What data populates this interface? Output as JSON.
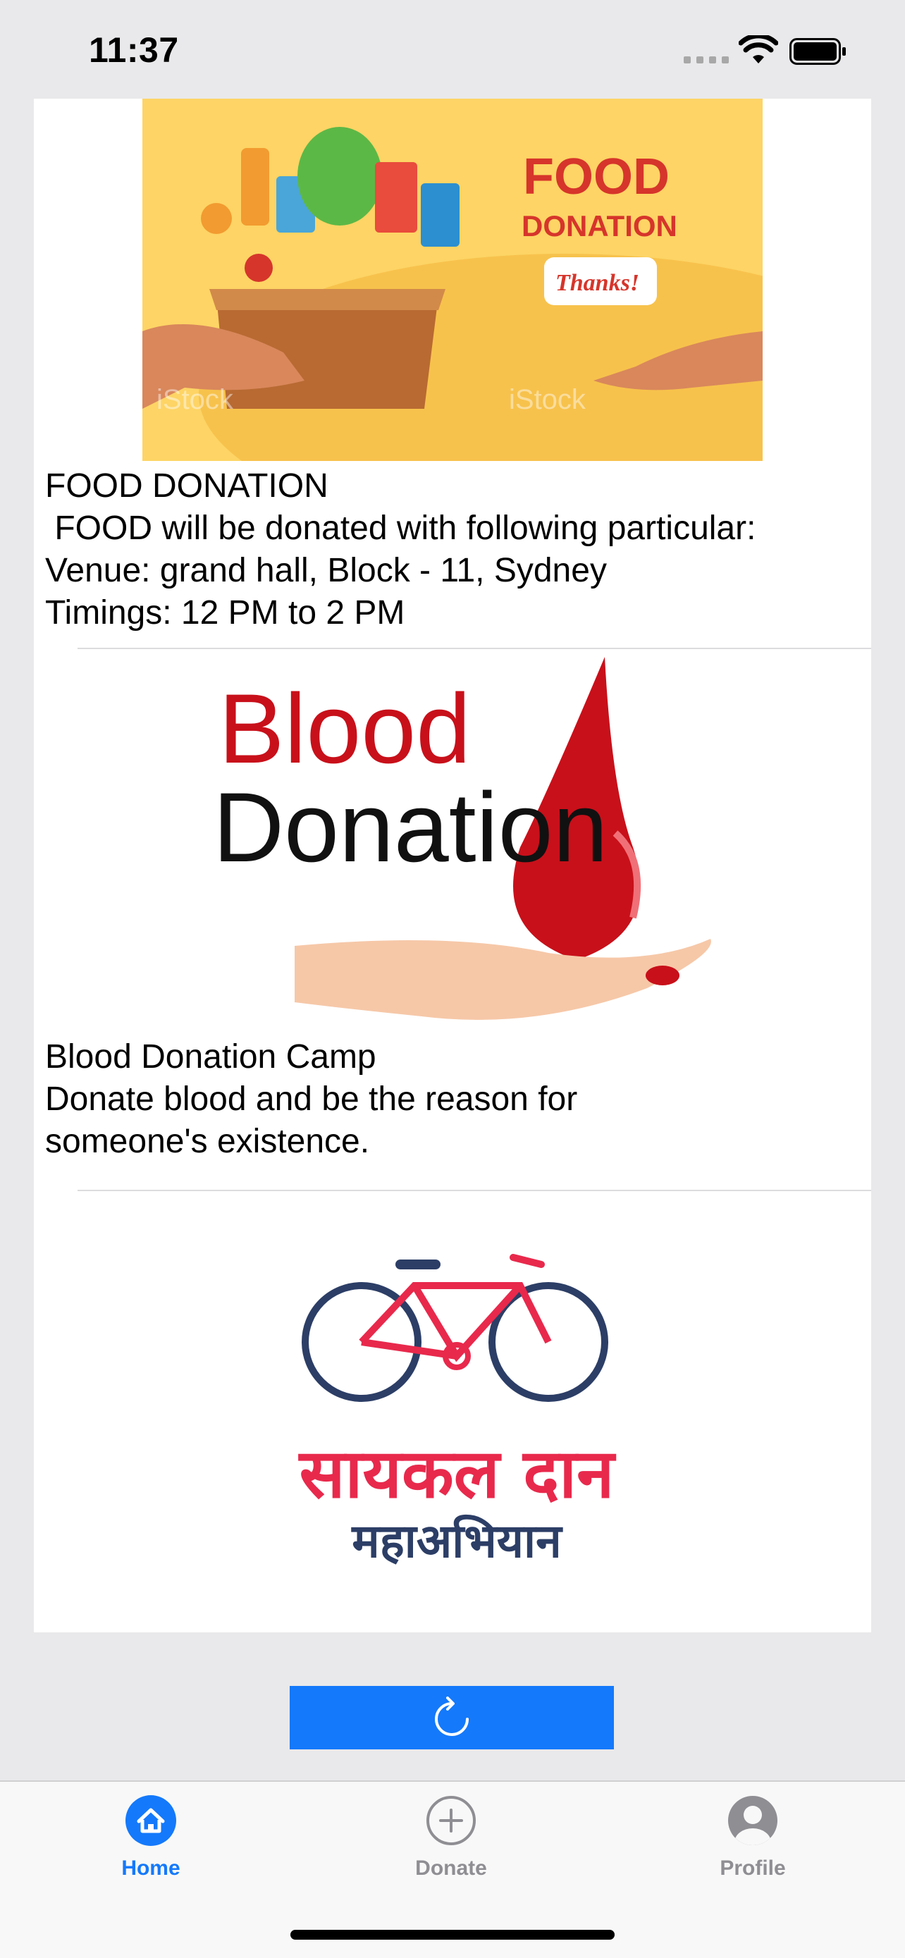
{
  "status_bar": {
    "time": "11:37"
  },
  "items": [
    {
      "image_name": "food-donation-image",
      "image_texts": {
        "food": "FOOD",
        "donation": "DONATION",
        "thanks": "Thanks!",
        "watermark": "iStock"
      },
      "lines": [
        "FOOD DONATION",
        " FOOD will be donated with following particular:",
        "Venue: grand hall, Block - 11, Sydney",
        "Timings: 12 PM to 2 PM"
      ]
    },
    {
      "image_name": "blood-donation-image",
      "image_texts": {
        "line1": "Blood",
        "line2": "Donation"
      },
      "lines": [
        "Blood Donation Camp",
        "Donate blood and be the reason for",
        "someone's existence."
      ]
    },
    {
      "image_name": "cycle-donation-image",
      "image_texts": {
        "line1": "सायकल दान",
        "line2": "महाअभियान"
      },
      "lines": []
    }
  ],
  "refresh_button": {
    "icon": "refresh-icon"
  },
  "tabs": [
    {
      "label": "Home",
      "icon": "house-icon",
      "active": true
    },
    {
      "label": "Donate",
      "icon": "plus-circle-icon",
      "active": false
    },
    {
      "label": "Profile",
      "icon": "person-circle-icon",
      "active": false
    }
  ],
  "colors": {
    "accent": "#1479fb",
    "inactive": "#8e8e93",
    "blood_red": "#d0121b",
    "food_red": "#d6352b"
  }
}
